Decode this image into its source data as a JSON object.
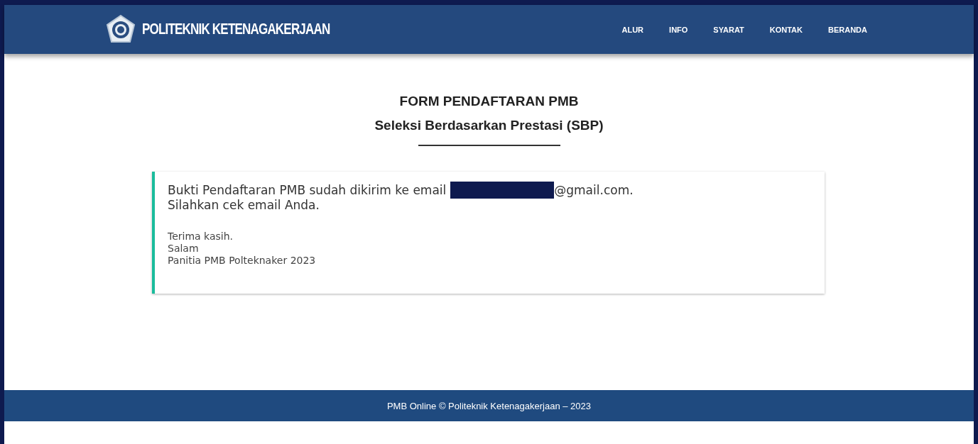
{
  "header": {
    "brand": "POLITEKNIK KETENAGAKERJAAN",
    "nav": [
      {
        "label": "ALUR"
      },
      {
        "label": "INFO"
      },
      {
        "label": "SYARAT"
      },
      {
        "label": "KONTAK"
      },
      {
        "label": "BERANDA"
      }
    ]
  },
  "form": {
    "title": "FORM PENDAFTARAN PMB",
    "subtitle": "Seleksi Berdasarkan Prestasi (SBP)"
  },
  "notice": {
    "message_start": "Bukti Pendaftaran PMB sudah dikirim ke email",
    "email_redacted": true,
    "email_end": "@gmail.com.",
    "message_line2": "Silahkan cek email Anda.",
    "closing": [
      "Terima kasih.",
      "Salam",
      "Panitia PMB Polteknaker 2023"
    ]
  },
  "footer": {
    "text": "PMB Online © Politeknik Ketenagakerjaan – 2023"
  }
}
